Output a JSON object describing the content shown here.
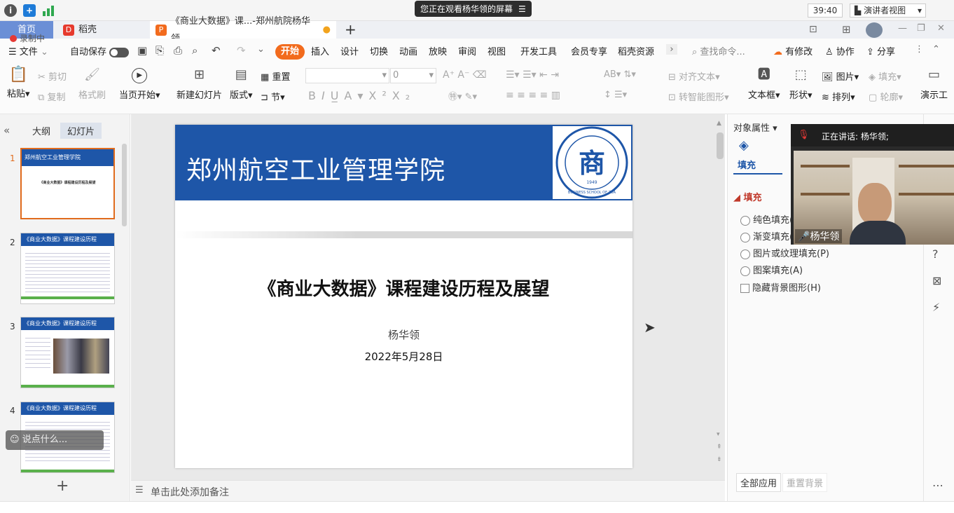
{
  "meeting": {
    "watching_text": "您正在观看杨华领的屏幕",
    "timer": "39:40",
    "presenter_view": "演讲者视图",
    "recording": "录制中"
  },
  "tabs": {
    "home": "首页",
    "daoke": "稻壳",
    "doc": "《商业大数据》课...-郑州航院杨华领"
  },
  "menu": {
    "file": "文件",
    "autosave": "自动保存",
    "items": [
      "开始",
      "插入",
      "设计",
      "切换",
      "动画",
      "放映",
      "审阅",
      "视图",
      "开发工具",
      "会员专享",
      "稻壳资源"
    ],
    "search": "查找命令...",
    "has_changes": "有修改",
    "collab": "协作",
    "share": "分享"
  },
  "ribbon": {
    "paste": "粘贴",
    "cut": "剪切",
    "copy": "复制",
    "format_brush": "格式刷",
    "play_from_current": "当页开始",
    "new_slide": "新建幻灯片",
    "layout": "版式",
    "reset": "重置",
    "section": "节",
    "font_size": "0",
    "align_text": "对齐文本",
    "convert_smartart": "转智能图形",
    "textbox": "文本框",
    "shape": "形状",
    "picture": "图片",
    "fill": "填充",
    "arrange": "排列",
    "outline": "轮廓",
    "present": "演示工"
  },
  "left_panel": {
    "tab_outline": "大纲",
    "tab_slides": "幻灯片",
    "slides": [
      {
        "num": "1",
        "header": "郑州航空工业管理学院",
        "title": "《商业大数据》课程建设历程及展望"
      },
      {
        "num": "2",
        "header": "《商业大数据》课程建设历程"
      },
      {
        "num": "3",
        "header": "《商业大数据》课程建设历程"
      },
      {
        "num": "4",
        "header": "《商业大数据》课程建设历程"
      }
    ],
    "comment_placeholder": "说点什么..."
  },
  "slide": {
    "school": "郑州航空工业管理学院",
    "title": "《商业大数据》课程建设历程及展望",
    "author": "杨华领",
    "date": "2022年5月28日",
    "logo_text": "BUSINESS SCHOOL OF ZUA",
    "logo_year": "1949",
    "logo_char": "商"
  },
  "notes_placeholder": "单击此处添加备注",
  "right_panel": {
    "object_properties": "对象属性",
    "fill_tab": "填充",
    "fill_section": "填充",
    "options": [
      "纯色填充(S)",
      "渐变填充(G)",
      "图片或纹理填充(P)",
      "图案填充(A)"
    ],
    "hide_bg": "隐藏背景图形(H)",
    "apply_all": "全部应用",
    "reset_bg": "重置背景"
  },
  "video": {
    "speaking": "正在讲话: 杨华领;",
    "name": "杨华领"
  },
  "colors": {
    "brand_blue": "#1e56a8",
    "accent_orange": "#f26b1d"
  }
}
